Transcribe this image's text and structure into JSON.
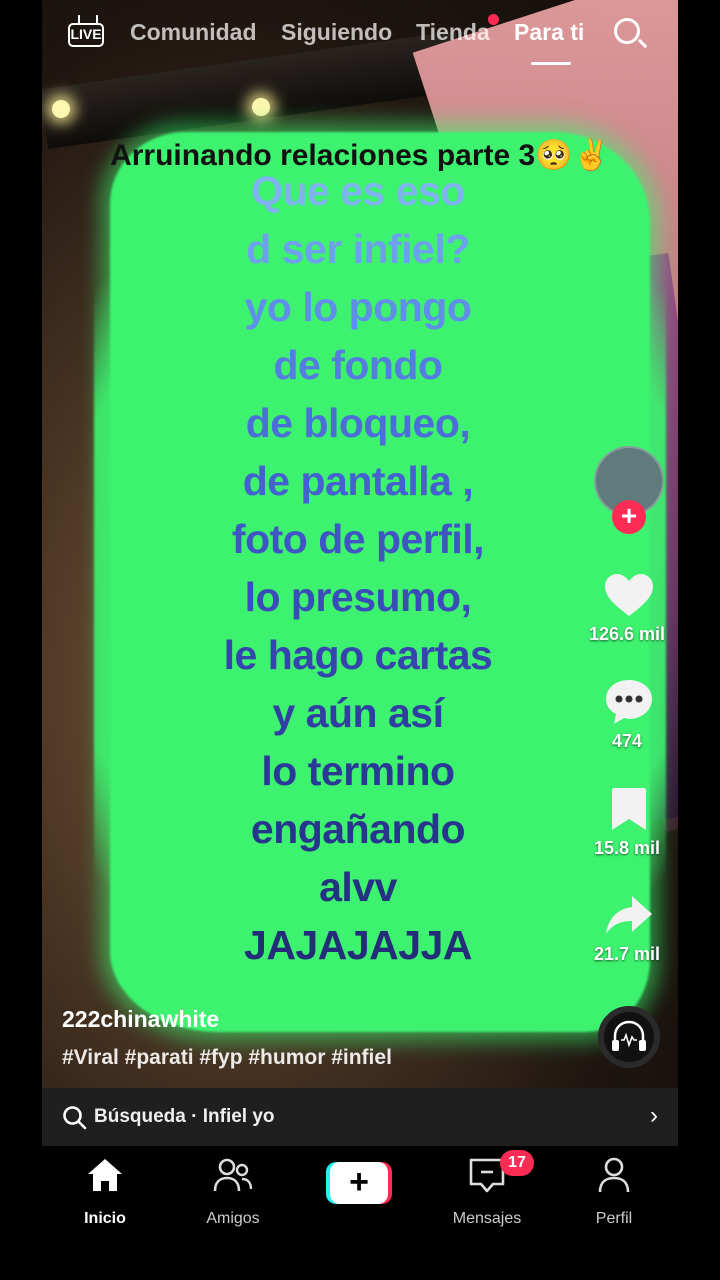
{
  "top_nav": {
    "live_label": "LIVE",
    "tabs": [
      "Comunidad",
      "Siguiendo",
      "Tienda",
      "Para ti"
    ],
    "active_tab": "Para ti"
  },
  "video": {
    "title_overlay": "Arruinando relaciones parte 3🥺✌️",
    "lines": [
      "Que es eso",
      "d ser infiel?",
      "yo lo pongo",
      "de fondo",
      "de bloqueo,",
      "de pantalla ,",
      "foto de perfil,",
      "lo presumo,",
      "le hago cartas",
      "y aún así",
      "lo termino",
      "engañando",
      "alvv",
      "JAJAJAJJA"
    ]
  },
  "side_actions": {
    "likes": "126.6 mil",
    "comments": "474",
    "saves": "15.8 mil",
    "shares": "21.7 mil"
  },
  "post": {
    "username": "222chinawhite",
    "hashtags": "#Viral #parati #fyp #humor #infiel"
  },
  "search_suggestion": {
    "label": "Búsqueda · Infiel yo"
  },
  "bottom_nav": {
    "home": "Inicio",
    "friends": "Amigos",
    "messages": "Mensajes",
    "profile": "Perfil",
    "messages_badge": "17"
  },
  "colors": {
    "accent_red": "#fe2c55",
    "accent_cyan": "#25f4ee",
    "green_blob": "#3cf26f"
  }
}
